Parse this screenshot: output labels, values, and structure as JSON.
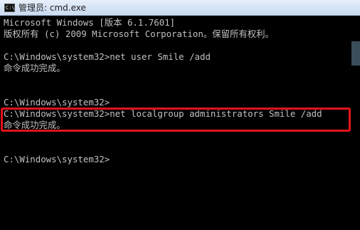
{
  "window": {
    "icon_text": "C:\\",
    "title": "管理员: cmd.exe"
  },
  "console": {
    "lines": [
      "Microsoft Windows [版本 6.1.7601]",
      "版权所有 (c) 2009 Microsoft Corporation。保留所有权利。",
      "",
      "C:\\Windows\\system32>net user Smile /add",
      "命令成功完成。",
      "",
      "",
      "C:\\Windows\\system32>",
      "C:\\Windows\\system32>net localgroup administrators Smile /add",
      "命令成功完成。",
      "",
      "",
      "C:\\Windows\\system32>"
    ]
  },
  "colors": {
    "console_background": "#000000",
    "console_text": "#c0c0c0",
    "highlight_border": "#e0141a"
  }
}
